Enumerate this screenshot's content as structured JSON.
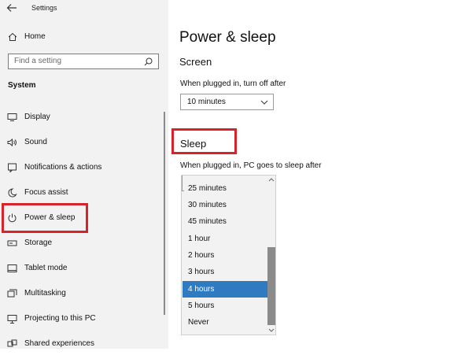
{
  "window": {
    "title": "Settings"
  },
  "sidebar": {
    "home_label": "Home",
    "search_placeholder": "Find a setting",
    "section": "System",
    "items": [
      {
        "label": "Display",
        "icon": "display-icon"
      },
      {
        "label": "Sound",
        "icon": "speaker-icon"
      },
      {
        "label": "Notifications & actions",
        "icon": "notification-icon"
      },
      {
        "label": "Focus assist",
        "icon": "moon-icon"
      },
      {
        "label": "Power & sleep",
        "icon": "power-icon",
        "highlighted": true
      },
      {
        "label": "Storage",
        "icon": "storage-icon"
      },
      {
        "label": "Tablet mode",
        "icon": "tablet-icon"
      },
      {
        "label": "Multitasking",
        "icon": "multitasking-icon"
      },
      {
        "label": "Projecting to this PC",
        "icon": "projector-icon"
      },
      {
        "label": "Shared experiences",
        "icon": "shared-icon"
      }
    ]
  },
  "main": {
    "title": "Power & sleep",
    "screen": {
      "heading": "Screen",
      "plugged_label": "When plugged in, turn off after",
      "value": "10 minutes"
    },
    "sleep": {
      "heading": "Sleep",
      "plugged_label": "When plugged in, PC goes to sleep after",
      "options": [
        "25 minutes",
        "30 minutes",
        "45 minutes",
        "1 hour",
        "2 hours",
        "3 hours",
        "4 hours",
        "5 hours",
        "Never"
      ],
      "selected": "4 hours"
    }
  },
  "colors": {
    "highlight": "#d8232a",
    "selected": "#2f7bc2",
    "sidebar_bg": "#f2f2f2"
  }
}
